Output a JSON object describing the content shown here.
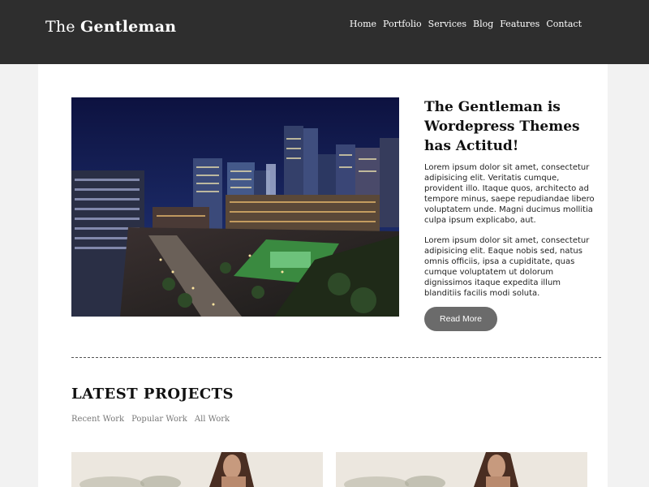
{
  "header": {
    "logo_light": "The",
    "logo_bold": "Gentleman",
    "nav": [
      "Home",
      "Portfolio",
      "Services",
      "Blog",
      "Features",
      "Contact"
    ]
  },
  "hero": {
    "title": "The Gentleman is Wordepress Themes has Actitud!",
    "paragraph1": "Lorem ipsum dolor sit amet, consectetur adipisicing elit. Veritatis cumque, provident illo. Itaque quos, architecto ad tempore minus, saepe repudiandae libero voluptatem unde. Magni ducimus mollitia culpa ipsum explicabo, aut.",
    "paragraph2": "Lorem ipsum dolor sit amet, consectetur adipisicing elit. Eaque nobis sed, natus omnis officiis, ipsa a cupiditate, quas cumque voluptatem ut dolorum dignissimos itaque expedita illum blanditiis facilis modi soluta.",
    "button": "Read More"
  },
  "projects": {
    "title": "LATEST PROJECTS",
    "filters": [
      "Recent Work",
      "Popular Work",
      "All Work"
    ]
  },
  "colors": {
    "header_bg": "#2e2e2e",
    "button_bg": "#6b6b6b"
  }
}
